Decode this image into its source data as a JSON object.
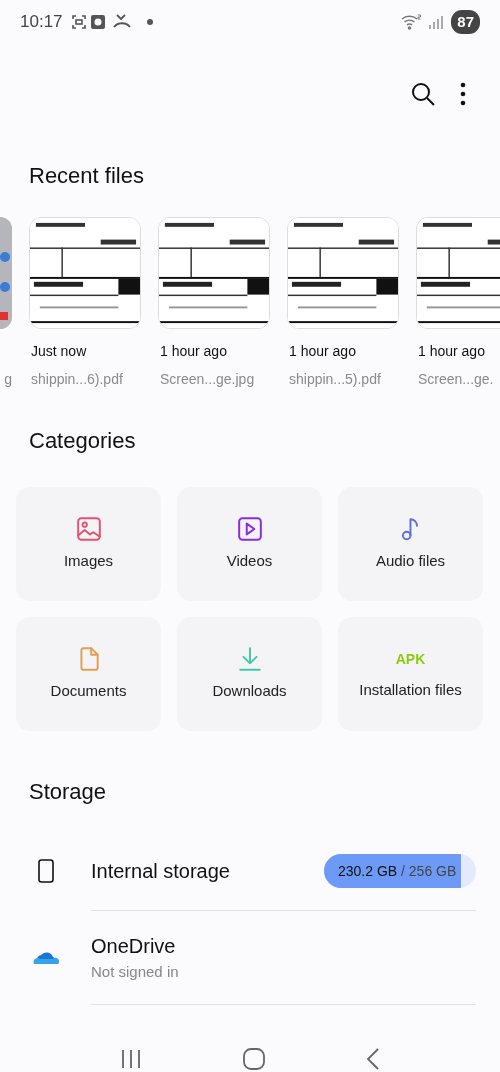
{
  "status_bar": {
    "time": "10:17",
    "battery": "87"
  },
  "recent_files": {
    "title": "Recent files",
    "items": [
      {
        "kind": "picture",
        "name": "g"
      },
      {
        "kind": "label",
        "time": "Just now",
        "name": "shippin...6).pdf"
      },
      {
        "kind": "label",
        "time": "1 hour ago",
        "name": "Screen...ge.jpg"
      },
      {
        "kind": "label",
        "time": "1 hour ago",
        "name": "shippin...5).pdf"
      },
      {
        "kind": "label",
        "time": "1 hour ago",
        "name": "Screen...ge."
      }
    ]
  },
  "categories": {
    "title": "Categories",
    "items": [
      {
        "kind": "images",
        "label": "Images",
        "color": "#e5526f"
      },
      {
        "kind": "videos",
        "label": "Videos",
        "color": "#8a2be2"
      },
      {
        "kind": "audio",
        "label": "Audio files",
        "color": "#5a6fe0"
      },
      {
        "kind": "documents",
        "label": "Documents",
        "color": "#e0a052"
      },
      {
        "kind": "downloads",
        "label": "Downloads",
        "color": "#3fc9a8"
      },
      {
        "kind": "apk",
        "label": "Installation files",
        "color": "#8ccc10",
        "icon_text": "APK"
      }
    ]
  },
  "storage": {
    "title": "Storage",
    "items": [
      {
        "kind": "internal",
        "name": "Internal storage",
        "used": "230.2 GB",
        "total": "/ 256 GB",
        "level": 0.9
      },
      {
        "kind": "cloud",
        "name": "OneDrive",
        "subtitle": "Not signed in"
      }
    ]
  }
}
